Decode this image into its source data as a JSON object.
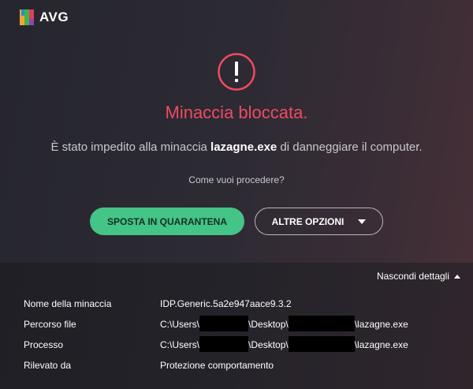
{
  "app": {
    "logo_text": "AVG"
  },
  "alert": {
    "icon": "exclamation-circle-icon",
    "title": "Minaccia bloccata.",
    "desc_prefix": "È stato impedito alla minaccia ",
    "threat_name": "lazagne.exe",
    "desc_suffix": " di danneggiare il computer.",
    "question": "Come vuoi procedere?"
  },
  "buttons": {
    "quarantine": "SPOSTA IN QUARANTENA",
    "more_options": "ALTRE OPZIONI"
  },
  "details": {
    "toggle_label": "Nascondi dettagli",
    "rows": [
      {
        "label": "Nome della minaccia",
        "value": "IDP.Generic.5a2e947aace9.3.2"
      },
      {
        "label": "Percorso file",
        "value_parts": [
          "C:\\Users\\",
          "\\Desktop\\",
          "\\lazagne.exe"
        ]
      },
      {
        "label": "Processo",
        "value_parts": [
          "C:\\Users\\",
          "\\Desktop\\",
          "\\lazagne.exe"
        ]
      },
      {
        "label": "Rilevato da",
        "value": "Protezione comportamento"
      }
    ]
  },
  "colors": {
    "accent_red": "#ef4a63",
    "accent_green": "#44c487",
    "background": "#2a2830"
  }
}
